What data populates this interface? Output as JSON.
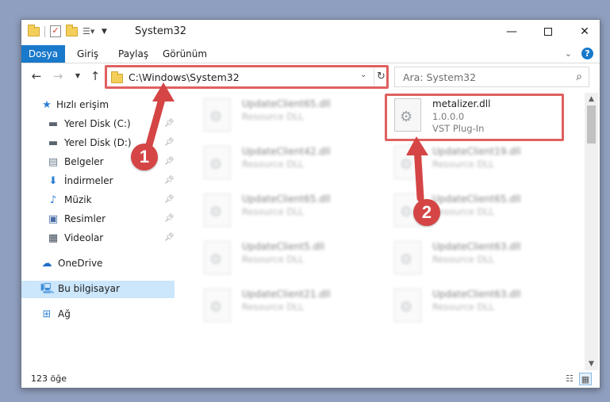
{
  "window": {
    "title": "System32",
    "min_label": "—",
    "close_label": "✕"
  },
  "ribbon": {
    "tabs": [
      "Dosya",
      "Giriş",
      "Paylaş",
      "Görünüm"
    ]
  },
  "nav": {
    "address": "C:\\Windows\\System32",
    "search_placeholder": "Ara: System32"
  },
  "sidebar": {
    "items": [
      {
        "label": "Hızlı erişim",
        "icon": "star-icon",
        "pinned": false
      },
      {
        "label": "Yerel Disk (C:)",
        "icon": "drive-icon",
        "pinned": true
      },
      {
        "label": "Yerel Disk (D:)",
        "icon": "drive-icon",
        "pinned": true
      },
      {
        "label": "Belgeler",
        "icon": "documents-icon",
        "pinned": true
      },
      {
        "label": "İndirmeler",
        "icon": "downloads-icon",
        "pinned": true
      },
      {
        "label": "Müzik",
        "icon": "music-icon",
        "pinned": true
      },
      {
        "label": "Resimler",
        "icon": "pictures-icon",
        "pinned": true
      },
      {
        "label": "Videolar",
        "icon": "videos-icon",
        "pinned": true
      },
      {
        "label": "OneDrive",
        "icon": "cloud-icon",
        "pinned": false
      },
      {
        "label": "Bu bilgisayar",
        "icon": "computer-icon",
        "pinned": false,
        "selected": true
      },
      {
        "label": "Ağ",
        "icon": "network-icon",
        "pinned": false
      }
    ]
  },
  "files": {
    "col1": [
      {
        "name": "UpdateClient65.dll",
        "line2": "Resource DLL"
      },
      {
        "name": "UpdateClient42.dll",
        "line2": "Resource DLL"
      },
      {
        "name": "UpdateClient65.dll",
        "line2": "Resource DLL"
      },
      {
        "name": "UpdateClient5.dll",
        "line2": "Resource DLL"
      },
      {
        "name": "UpdateClient21.dll",
        "line2": "Resource DLL"
      }
    ],
    "col2": [
      {
        "name": "metalizer.dll",
        "line2": "1.0.0.0",
        "line3": "VST Plug-In"
      },
      {
        "name": "UpdateClient19.dll",
        "line2": "Resource DLL"
      },
      {
        "name": "UpdateClient65.dll",
        "line2": "Resource DLL"
      },
      {
        "name": "UpdateClient63.dll",
        "line2": "Resource DLL"
      },
      {
        "name": "UpdateClient63.dll",
        "line2": "Resource DLL"
      }
    ]
  },
  "status": {
    "count": "123 öğe"
  },
  "callouts": [
    "1",
    "2"
  ],
  "colors": {
    "accent": "#1979ca",
    "highlight": "#e06060",
    "badge": "#d54545",
    "desktop": "#8f9fbf"
  }
}
